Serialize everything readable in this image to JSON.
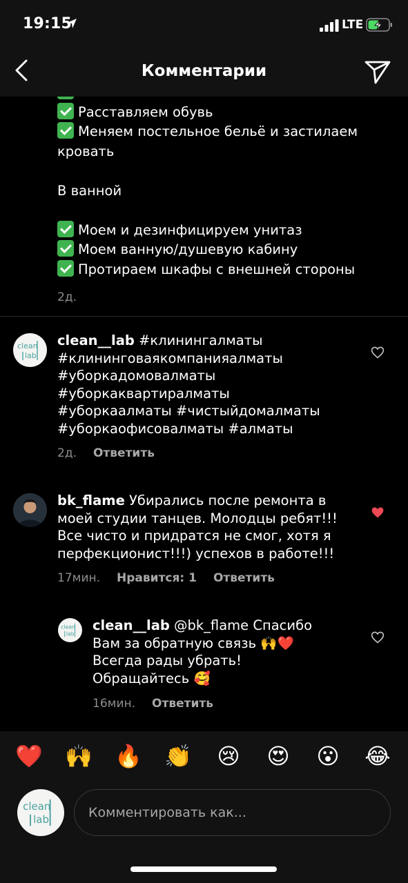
{
  "status": {
    "time": "19:15",
    "network": "LTE"
  },
  "header": {
    "title": "Комментарии"
  },
  "caption": {
    "lines": [
      "Расставляем обувь",
      "Меняем постельное бельё и застилаем",
      "кровать",
      "",
      "В ванной",
      "",
      "Моем и дезинфицируем унитаз",
      "Моем ванную/душевую кабину",
      "Протираем шкафы с внешней стороны"
    ],
    "time": "2д."
  },
  "comments": [
    {
      "username": "clean__lab",
      "text": "#клинингалматы #клининговаякомпанияалматы #уборкадомовалматы #уборкаквартиралматы #уборкаалматы #чистыйдомалматы #уборкаофисовалматы #алматы",
      "lines": [
        "#клинингалматы",
        "#клининговаякомпанияалматы",
        "#уборкадомовалматы",
        "#уборкаквартиралматы",
        "#уборкаалматы #чистыйдомалматы",
        "#уборкаофисовалматы #алматы"
      ],
      "time": "2д.",
      "reply": "Ответить",
      "liked": false
    },
    {
      "username": "bk_flame",
      "lines": [
        "Убирались после ремонта в",
        "моей студии танцев. Молодцы ребят!!!",
        "Все чисто и придратся не смог, хотя я",
        "перфекционист!!!) успехов в работе!!!"
      ],
      "time": "17мин.",
      "likes": "Нравится: 1",
      "reply": "Ответить",
      "liked": true
    },
    {
      "username": "clean__lab",
      "lines": [
        "@bk_flame Спасибо",
        "Вам за обратную связь 🙌❤️",
        "Всегда рады убрать!",
        "Обращайтесь 🥰"
      ],
      "time": "16мин.",
      "reply": "Ответить",
      "liked": false
    }
  ],
  "logo": {
    "top": "clean",
    "bottom": "lab"
  },
  "emoji_bar": [
    "❤️",
    "🙌",
    "🔥",
    "👏",
    "😢",
    "😍",
    "😮",
    "😂"
  ],
  "composer": {
    "placeholder": "Комментировать как..."
  },
  "colors": {
    "background": "#000000",
    "bar": "#121212",
    "muted": "#8e8e8e",
    "check": "#3fb34f",
    "liked_heart": "#ed4956"
  }
}
